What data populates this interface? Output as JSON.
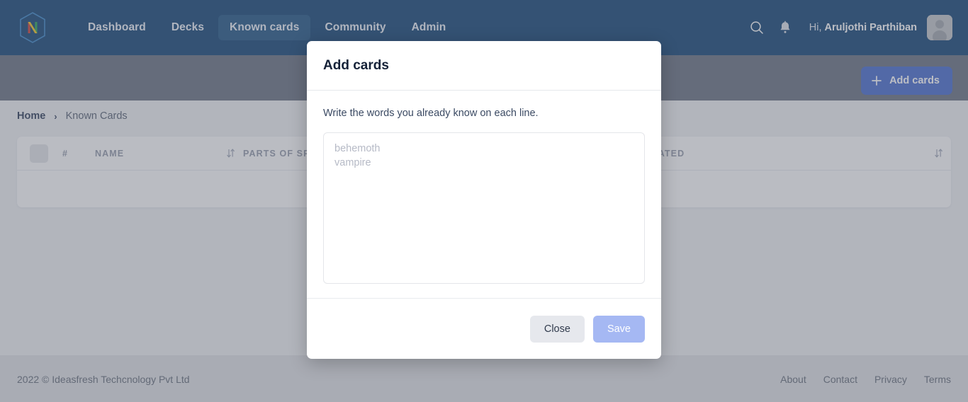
{
  "navbar": {
    "logo_alt": "nexus-hexagon-logo",
    "links": [
      {
        "label": "Dashboard",
        "active": false
      },
      {
        "label": "Decks",
        "active": false
      },
      {
        "label": "Known cards",
        "active": true
      },
      {
        "label": "Community",
        "active": false
      },
      {
        "label": "Admin",
        "active": false
      }
    ],
    "search_icon": "search-icon",
    "notification_icon": "bell-icon",
    "greeting_prefix": "Hi, ",
    "user_name": "Aruljothi Parthiban",
    "avatar_alt": "user-avatar"
  },
  "hero": {
    "add_cards_label": "Add cards",
    "add_cards_icon": "plus-icon"
  },
  "breadcrumb": {
    "home": "Home",
    "separator": "›",
    "current": "Known Cards"
  },
  "table": {
    "columns": [
      {
        "key": "checkbox",
        "label": ""
      },
      {
        "key": "index",
        "label": "#"
      },
      {
        "key": "name",
        "label": "NAME",
        "sortable": true
      },
      {
        "key": "parts_of_speech",
        "label": "PARTS OF SPEECH"
      },
      {
        "key": "created",
        "label": "CREATED",
        "sortable": true
      }
    ],
    "rows": [],
    "sort_icon": "sort-updown-icon"
  },
  "modal": {
    "title": "Add cards",
    "hint": "Write the words you already know on each line.",
    "textarea_value": "",
    "textarea_placeholder": "behemoth\nvampire",
    "close_label": "Close",
    "save_label": "Save"
  },
  "footer": {
    "copyright": "2022 © Ideasfresh Techcnology Pvt Ltd",
    "links": [
      "About",
      "Contact",
      "Privacy",
      "Terms"
    ]
  },
  "colors": {
    "navbar_bg": "#05386b",
    "nav_active_bg": "#134a7c",
    "primary_button": "#3c63c9",
    "save_button": "#a5b8f3",
    "close_button": "#e6e8ed",
    "content_bg": "#eceef1",
    "footer_bg": "#dcdee1"
  }
}
